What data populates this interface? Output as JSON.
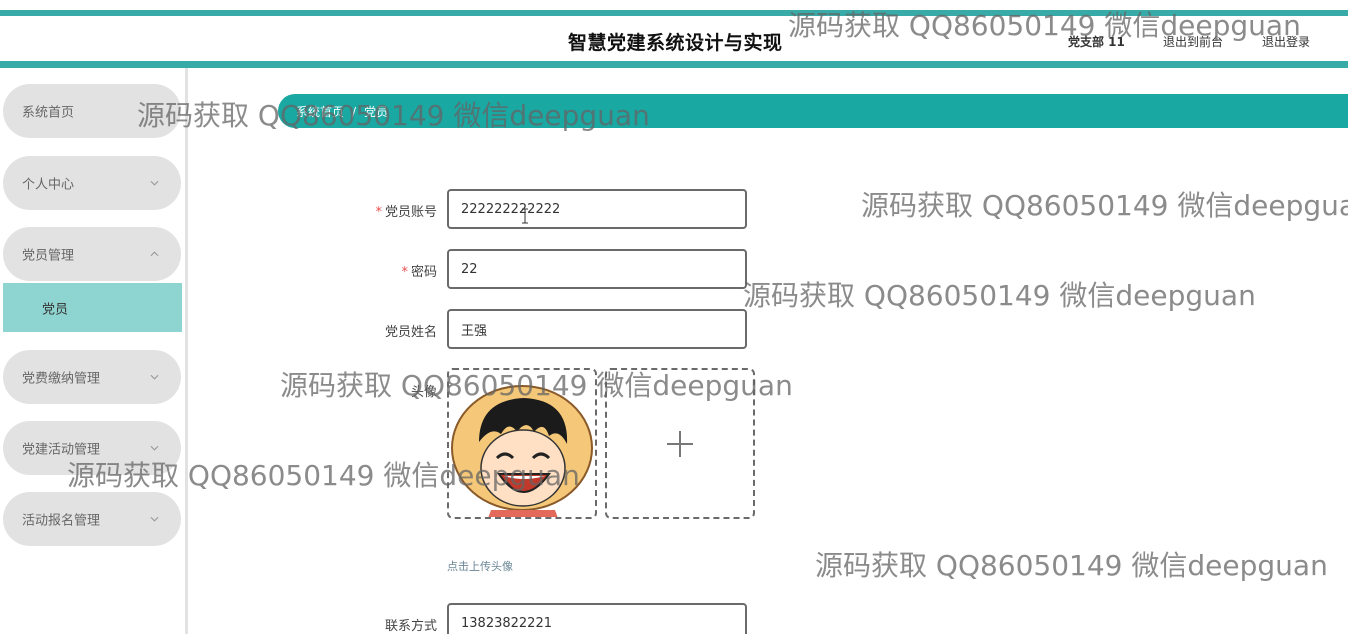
{
  "header": {
    "title": "智慧党建系统设计与实现",
    "user": "党支部 11",
    "front_link": "退出到前台",
    "logout_link": "退出登录"
  },
  "sidebar": {
    "items": [
      {
        "label": "系统首页",
        "chevron": ""
      },
      {
        "label": "个人中心",
        "chevron": "chevron-down"
      },
      {
        "label": "党员管理",
        "chevron": "chevron-up"
      },
      {
        "label": "党费缴纳管理",
        "chevron": "chevron-down"
      },
      {
        "label": "党建活动管理",
        "chevron": "chevron-down"
      },
      {
        "label": "活动报名管理",
        "chevron": "chevron-down"
      }
    ],
    "sub_item": "党员"
  },
  "breadcrumb": {
    "home": "系统首页",
    "separator": "/",
    "current": "党员"
  },
  "form": {
    "account": {
      "label": "党员账号",
      "value": "222222222222",
      "required": "*"
    },
    "password": {
      "label": "密码",
      "value": "22",
      "required": "*"
    },
    "name": {
      "label": "党员姓名",
      "value": "王强"
    },
    "avatar": {
      "label": "头像",
      "hint": "点击上传头像"
    },
    "contact": {
      "label": "联系方式",
      "value": "13823822221"
    }
  },
  "watermark": "源码获取 QQ86050149 微信deepguan",
  "colors": {
    "accent": "#38aaa7",
    "breadcrumb_bg": "#1aa8a3",
    "active_sub_item": "#8ed4d0",
    "menu_bg": "#e2e2e2",
    "required": "#e8504f"
  }
}
